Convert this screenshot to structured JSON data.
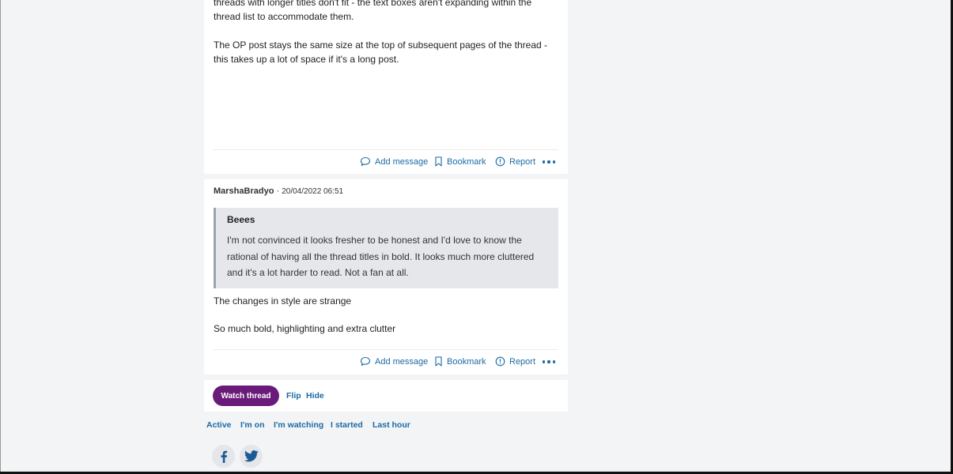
{
  "first_post": {
    "paragraphs": [
      "threads with longer titles don't fit - the text boxes aren't expanding within the thread list to accommodate them.",
      "The OP post stays the same size at the top of subsequent pages of the thread - this takes up a lot of space if it's a long post."
    ],
    "actions": {
      "add_message": "Add message",
      "bookmark": "Bookmark",
      "report": "Report"
    }
  },
  "second_post": {
    "author": "MarshaBradyo",
    "separator": "·",
    "date": "20/04/2022 06:51",
    "quote": {
      "author": "Beees",
      "text": "I'm not convinced it looks fresher to be honest and I'd love to know the rational of having all the thread titles in bold. It looks much more cluttered and it's a lot harder to read. Not a fan at all."
    },
    "paragraphs": [
      "The changes in style are strange",
      "So much bold, highlighting and extra clutter"
    ],
    "actions": {
      "add_message": "Add message",
      "bookmark": "Bookmark",
      "report": "Report"
    }
  },
  "thread_controls": {
    "watch": "Watch thread",
    "flip": "Flip",
    "hide": "Hide"
  },
  "filters": {
    "active": "Active",
    "im_on": "I'm on",
    "im_watching": "I'm watching",
    "i_started": "I started",
    "last_hour": "Last hour"
  },
  "social": {
    "facebook_icon": "facebook-icon",
    "twitter_icon": "twitter-icon"
  },
  "colors": {
    "link": "#1b6aa5",
    "watch_button": "#6a1b7a",
    "quote_bg": "#e5e7eb",
    "page_bg": "#f3f4f6"
  }
}
